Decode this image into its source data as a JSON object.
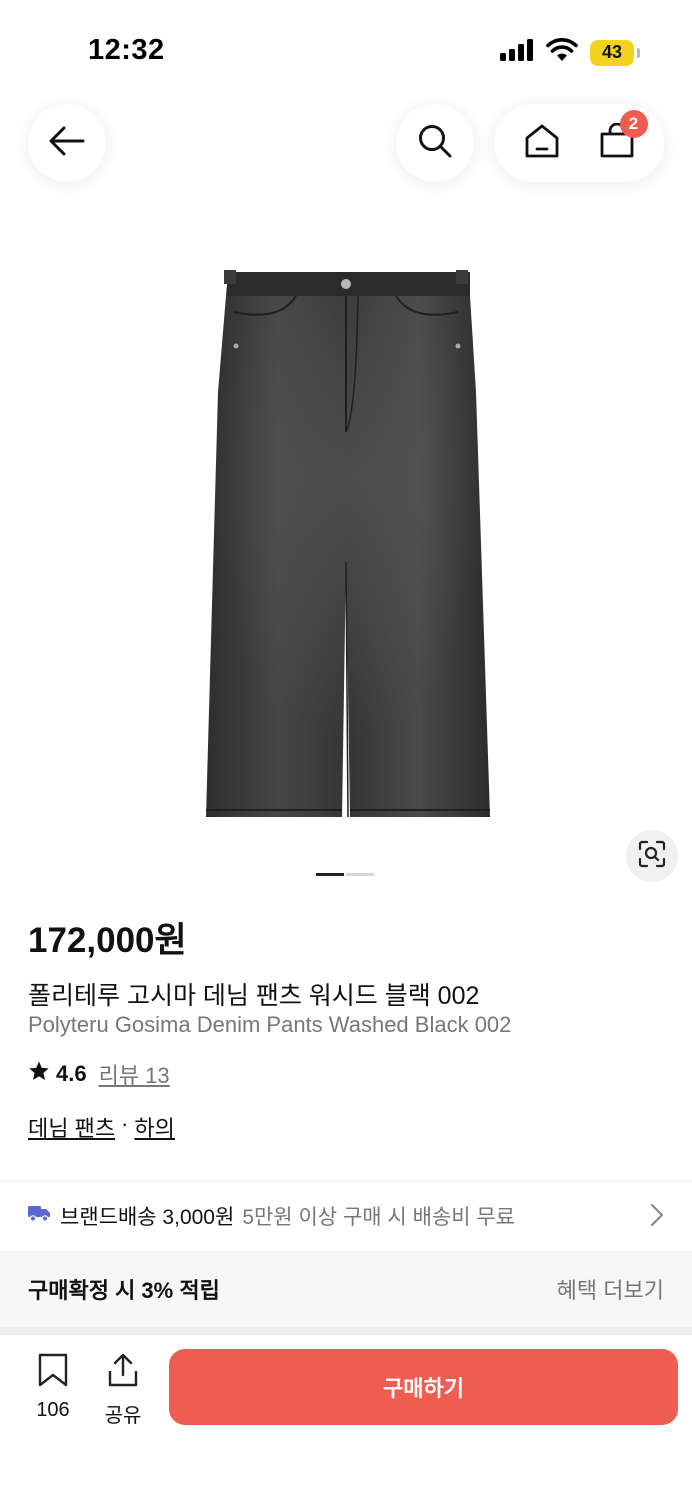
{
  "status_bar": {
    "time": "12:32",
    "battery": "43",
    "battery_color": "#f5d31c",
    "icons": [
      "signal-icon",
      "wifi-icon",
      "battery-icon"
    ]
  },
  "header": {
    "icons": [
      "back-arrow-icon",
      "search-icon",
      "home-icon",
      "shopping-bag-icon"
    ],
    "cart_count": "2"
  },
  "gallery": {
    "icons": [
      "image-search-icon"
    ],
    "image_count": 2,
    "active_index": 0
  },
  "product": {
    "price": "172,000원",
    "name_ko": "폴리테루 고시마 데님 팬츠 워시드 블랙 002",
    "name_en": "Polyteru Gosima Denim Pants Washed Black 002",
    "rating": "4.6",
    "review_label": "리뷰 13",
    "category_main": "데님 팬츠",
    "category_separator": "·",
    "category_sub": "하의"
  },
  "shipping": {
    "brand_label": "브랜드배송 3,000원",
    "note": "5만원 이상 구매 시 배송비 무료",
    "icon": "truck-icon",
    "icon_color": "#5b67d6"
  },
  "benefit": {
    "label": "구매확정 시 3% 적립",
    "more": "혜택 더보기"
  },
  "bottom_bar": {
    "bookmark_count": "106",
    "share_label": "공유",
    "buy_label": "구매하기",
    "accent": "#ee5d50"
  }
}
